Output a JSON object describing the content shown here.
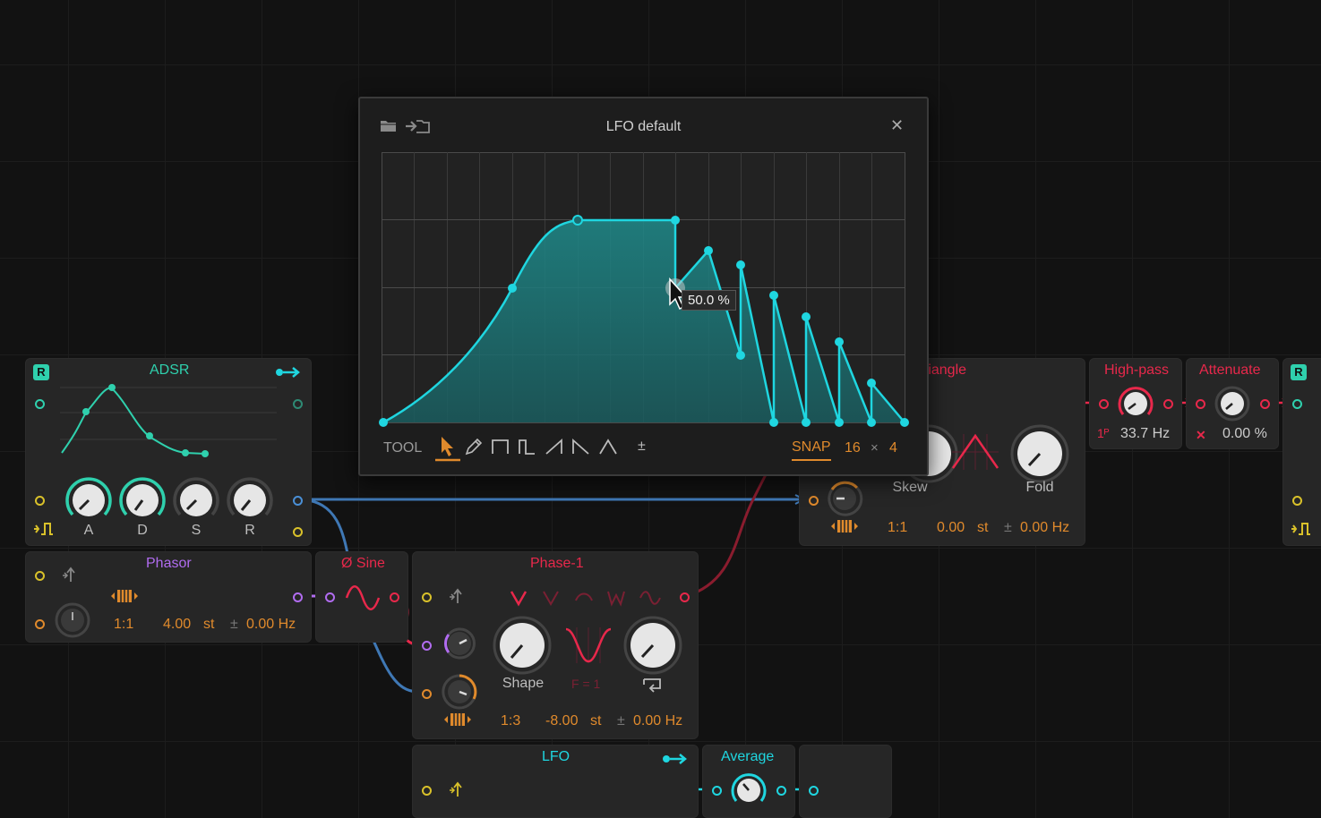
{
  "dialog": {
    "title": "LFO default",
    "close_label": "✕",
    "tooltip": "50.0 %",
    "tool_label": "TOOL",
    "bipolar_label": "±",
    "snap_label": "SNAP",
    "snap_x": "16",
    "snap_times": "×",
    "snap_y": "4"
  },
  "adsr": {
    "badge": "R",
    "title": "ADSR",
    "knobs": [
      "A",
      "D",
      "S",
      "R"
    ]
  },
  "phasor": {
    "title": "Phasor",
    "ratio": "1:1",
    "pitch": "4.00",
    "pitch_unit": "st",
    "pm": "±",
    "freq": "0.00 Hz"
  },
  "sine": {
    "title": "Ø Sine"
  },
  "phase1": {
    "title": "Phase-1",
    "shape_label": "Shape",
    "fold_readout": "F = 1",
    "ratio": "1:3",
    "pitch": "-8.00",
    "pitch_unit": "st",
    "pm": "±",
    "freq": "0.00 Hz"
  },
  "triangle": {
    "title": "Triangle",
    "title_visible": "riangle",
    "skew_label": "Skew",
    "fold_label": "Fold",
    "ratio": "1:1",
    "pitch": "0.00",
    "pitch_unit": "st",
    "pm": "±",
    "freq": "0.00 Hz"
  },
  "highpass": {
    "title": "High-pass",
    "order": "1ᴾ",
    "freq": "33.7 Hz"
  },
  "attenuate": {
    "title": "Attenuate",
    "mode_icon": "✕",
    "amount": "0.00 %"
  },
  "right_module": {
    "badge": "R"
  },
  "lfo": {
    "title": "LFO"
  },
  "average": {
    "title": "Average"
  },
  "colors": {
    "teal": "#2fd0ad",
    "cyan": "#1fd6e0",
    "red": "#e8284b",
    "orange": "#e08a2c",
    "purple": "#b16cf0",
    "yellow": "#d9c12a",
    "blue": "#4a8fd6"
  },
  "icons": [
    "folder-icon",
    "import-icon",
    "close-icon",
    "pointer-tool-icon",
    "pencil-tool-icon",
    "square-tool-icon",
    "pulse-tool-icon",
    "ramp-up-tool-icon",
    "ramp-down-tool-icon",
    "triangle-tool-icon",
    "piano-keys-icon",
    "retrigger-icon",
    "gate-icon"
  ]
}
